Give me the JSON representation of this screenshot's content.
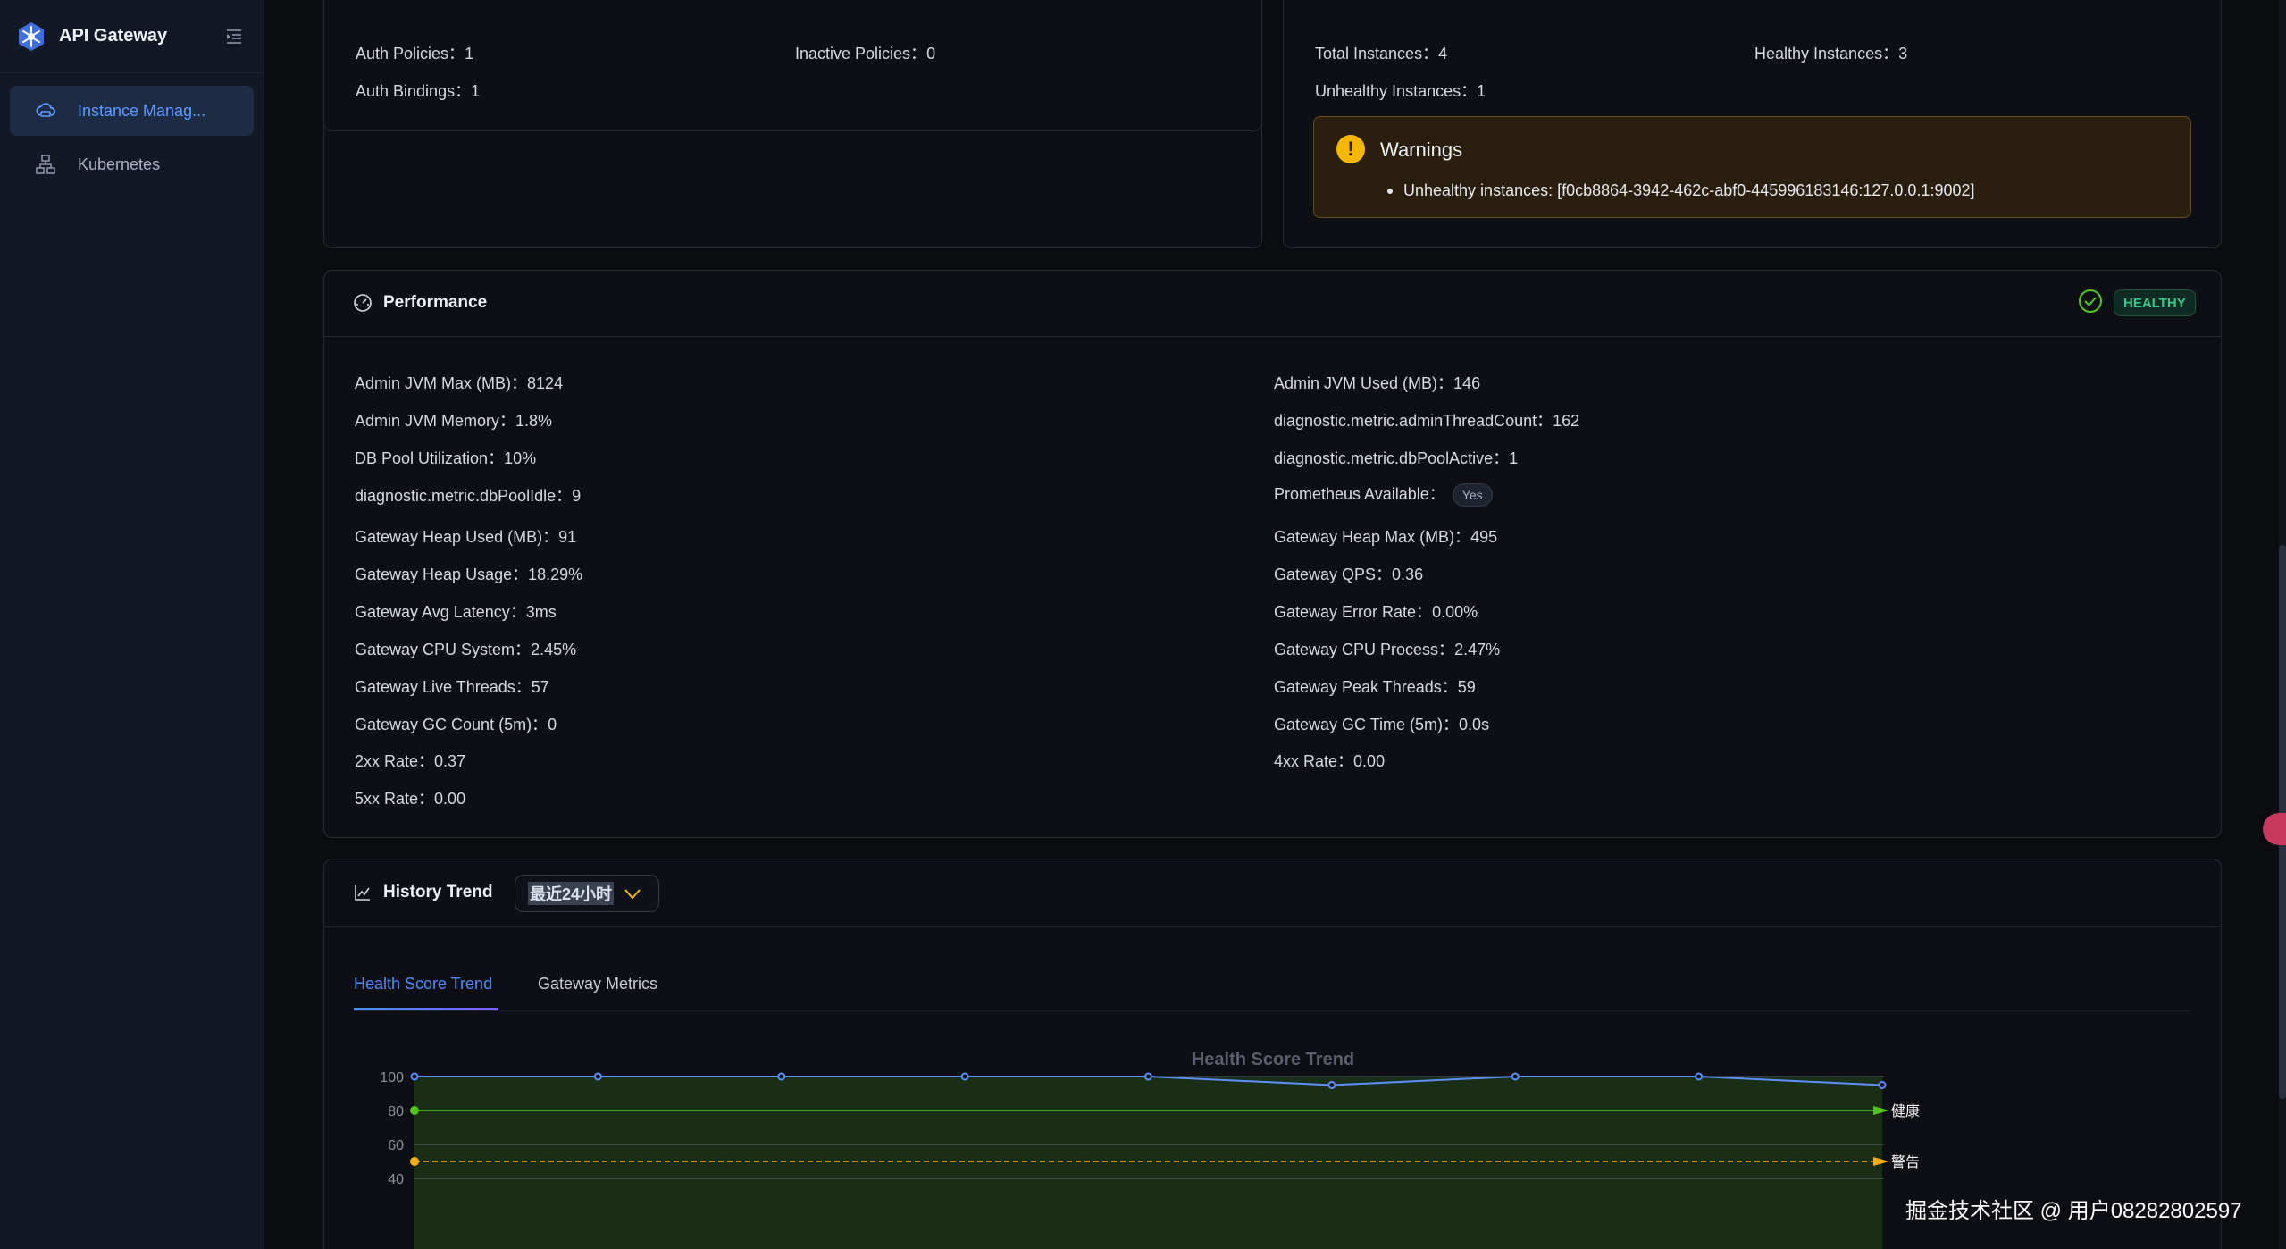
{
  "sidebar": {
    "brand": "API Gateway",
    "items": [
      {
        "label": "Instance Manag...",
        "active": true
      },
      {
        "label": "Kubernetes",
        "active": false
      }
    ]
  },
  "auth": {
    "policies_label": "Auth Policies：",
    "policies_value": "1",
    "inactive_label": "Inactive Policies：",
    "inactive_value": "0",
    "bindings_label": "Auth Bindings：",
    "bindings_value": "1"
  },
  "instances": {
    "total_label": "Total Instances：",
    "total_value": "4",
    "healthy_label": "Healthy Instances：",
    "healthy_value": "3",
    "unhealthy_label": "Unhealthy Instances：",
    "unhealthy_value": "1",
    "warning_title": "Warnings",
    "warning_item": "Unhealthy instances: [f0cb8864-3942-462c-abf0-445996183146:127.0.0.1:9002]"
  },
  "performance": {
    "title": "Performance",
    "status": "HEALTHY",
    "yes": "Yes",
    "left": [
      {
        "k": "Admin JVM Max (MB)：",
        "v": "8124"
      },
      {
        "k": "Admin JVM Memory：",
        "v": "1.8%"
      },
      {
        "k": "DB Pool Utilization：",
        "v": "10%"
      },
      {
        "k": "diagnostic.metric.dbPoolIdle：",
        "v": "9"
      },
      {
        "k": "Gateway Heap Used (MB)：",
        "v": "91"
      },
      {
        "k": "Gateway Heap Usage：",
        "v": "18.29%"
      },
      {
        "k": "Gateway Avg Latency：",
        "v": "3ms"
      },
      {
        "k": "Gateway CPU System：",
        "v": "2.45%"
      },
      {
        "k": "Gateway Live Threads：",
        "v": "57"
      },
      {
        "k": "Gateway GC Count (5m)：",
        "v": "0"
      },
      {
        "k": "2xx Rate：",
        "v": "0.37"
      },
      {
        "k": "5xx Rate：",
        "v": "0.00"
      }
    ],
    "right": [
      {
        "k": "Admin JVM Used (MB)：",
        "v": "146"
      },
      {
        "k": "diagnostic.metric.adminThreadCount：",
        "v": "162"
      },
      {
        "k": "diagnostic.metric.dbPoolActive：",
        "v": "1"
      },
      {
        "k": "Prometheus Available：",
        "v": ""
      },
      {
        "k": "Gateway Heap Max (MB)：",
        "v": "495"
      },
      {
        "k": "Gateway QPS：",
        "v": "0.36"
      },
      {
        "k": "Gateway Error Rate：",
        "v": "0.00%"
      },
      {
        "k": "Gateway CPU Process：",
        "v": "2.47%"
      },
      {
        "k": "Gateway Peak Threads：",
        "v": "59"
      },
      {
        "k": "Gateway GC Time (5m)：",
        "v": "0.0s"
      },
      {
        "k": "4xx Rate：",
        "v": "0.00"
      }
    ]
  },
  "history": {
    "title": "History Trend",
    "range": "最近24小时",
    "tabs": [
      "Health Score Trend",
      "Gateway Metrics"
    ]
  },
  "chart_data": {
    "type": "line",
    "title": "Health Score Trend",
    "ylim": [
      40,
      100
    ],
    "yticks": [
      "100",
      "80",
      "60",
      "40"
    ],
    "series": [
      {
        "values": [
          100,
          100,
          100,
          100,
          100,
          95,
          100,
          100,
          95
        ]
      }
    ],
    "thresholds": [
      80,
      50
    ],
    "threshold_labels": [
      "健康",
      "警告"
    ],
    "colors": {
      "line": "#5b8ff9",
      "area": "#1a2e16",
      "healthy": "#52c41a",
      "warning": "#faad14"
    }
  },
  "watermark": "掘金技术社区 @ 用户08282802597"
}
